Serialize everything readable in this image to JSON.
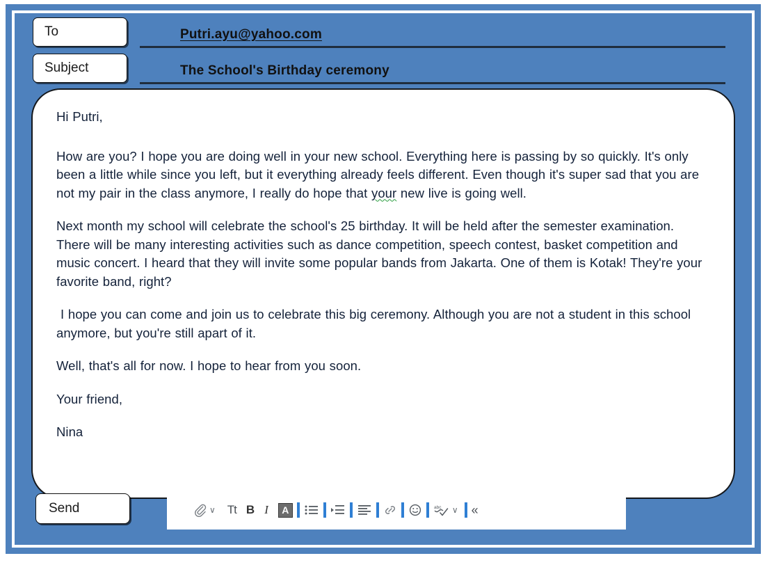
{
  "window": {
    "frame_color": "#4e81bd",
    "panel_color": "#ffffff"
  },
  "compose": {
    "to": {
      "label": "To",
      "value": "Putri.ayu@yahoo.com"
    },
    "subject": {
      "label": "Subject",
      "value": "The School's Birthday ceremony"
    },
    "body": {
      "greeting": "Hi Putri,",
      "paragraph_1_a": "How are you? I hope you are doing well in your new school. Everything here is passing by so quickly. It's only been a little while since you left, but it everything already feels different. Even though it's super sad that you are not my pair in the class anymore, I really do hope that ",
      "paragraph_1_grammar": "your",
      "paragraph_1_b": " new live is going well.",
      "paragraph_2": "Next month my school will celebrate the school's 25 birthday. It will be held after the semester examination. There will be many interesting activities such as dance competition, speech contest, basket competition and music concert. I heard that they will invite some popular bands from Jakarta. One of them is Kotak! They're your favorite band, right?",
      "paragraph_3": "I hope you can come and join us to celebrate this big ceremony. Although you are not a student in this school anymore, but you're still apart of it.",
      "paragraph_4": "Well, that's all for now. I hope to hear from you soon.",
      "closing": "Your friend,",
      "signature": "Nina"
    }
  },
  "footer": {
    "send_label": "Send",
    "toolbar": {
      "separator_color": "#2f7fd4",
      "items": [
        {
          "name": "attach-icon",
          "glyph": "paperclip"
        },
        {
          "name": "attach-dropdown-chevron-icon",
          "glyph": "∨"
        },
        {
          "name": "font-size-icon",
          "glyph": "Tt"
        },
        {
          "name": "bold-icon",
          "glyph": "B"
        },
        {
          "name": "italic-icon",
          "glyph": "I"
        },
        {
          "name": "text-highlight-icon",
          "glyph": "A"
        },
        {
          "name": "bulleted-list-icon",
          "glyph": "list"
        },
        {
          "name": "indent-icon",
          "glyph": "indent"
        },
        {
          "name": "align-icon",
          "glyph": "align"
        },
        {
          "name": "link-icon",
          "glyph": "link"
        },
        {
          "name": "emoji-icon",
          "glyph": "☺"
        },
        {
          "name": "spell-check-icon",
          "glyph": "abc-check"
        },
        {
          "name": "spell-check-dropdown-chevron-icon",
          "glyph": "∨"
        },
        {
          "name": "collapse-toolbar-icon",
          "glyph": "«"
        }
      ]
    }
  }
}
